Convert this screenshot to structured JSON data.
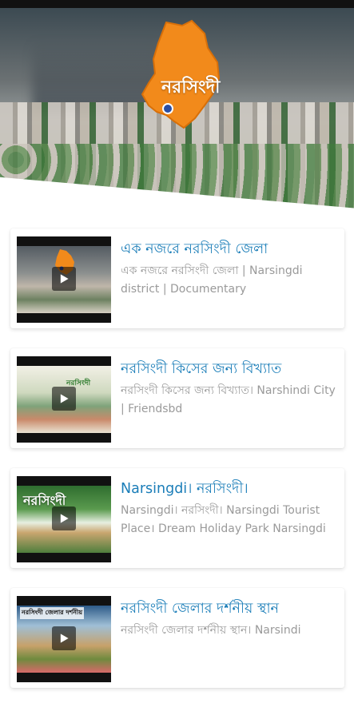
{
  "banner": {
    "district_label": "নরসিংদী"
  },
  "videos": [
    {
      "title": "এক নজরে নরসিংদী জেলা",
      "desc": "এক নজরে নরসিংদী জেলা | Narsingdi district | Documentary",
      "thumb_label": ""
    },
    {
      "title": "নরসিংদী কিসের জন্য বিখ্যাত",
      "desc": "নরসিংদী কিসের জন্য বিখ্যাত। Narshindi City | Friendsbd",
      "thumb_label": "নরসিংদী"
    },
    {
      "title": "Narsingdi। নরসিংদী।",
      "desc": "Narsingdi। নরসিংদী। Narsingdi Tourist Place। Dream Holiday Park Narsingdi",
      "thumb_label": "নরসিংদী"
    },
    {
      "title": "নরসিংদী জেলার দর্শনীয় স্থান",
      "desc": "নরসিংদী জেলার দর্শনীয় স্থান। Narsindi",
      "thumb_label": "নরসিংদী জেলার দর্শনীয়"
    }
  ],
  "icons": {
    "play": "play-icon",
    "map": "map-icon"
  },
  "colors": {
    "title": "#1a7db8",
    "desc": "#9a9a9a",
    "map_orange": "#f28a1b"
  }
}
